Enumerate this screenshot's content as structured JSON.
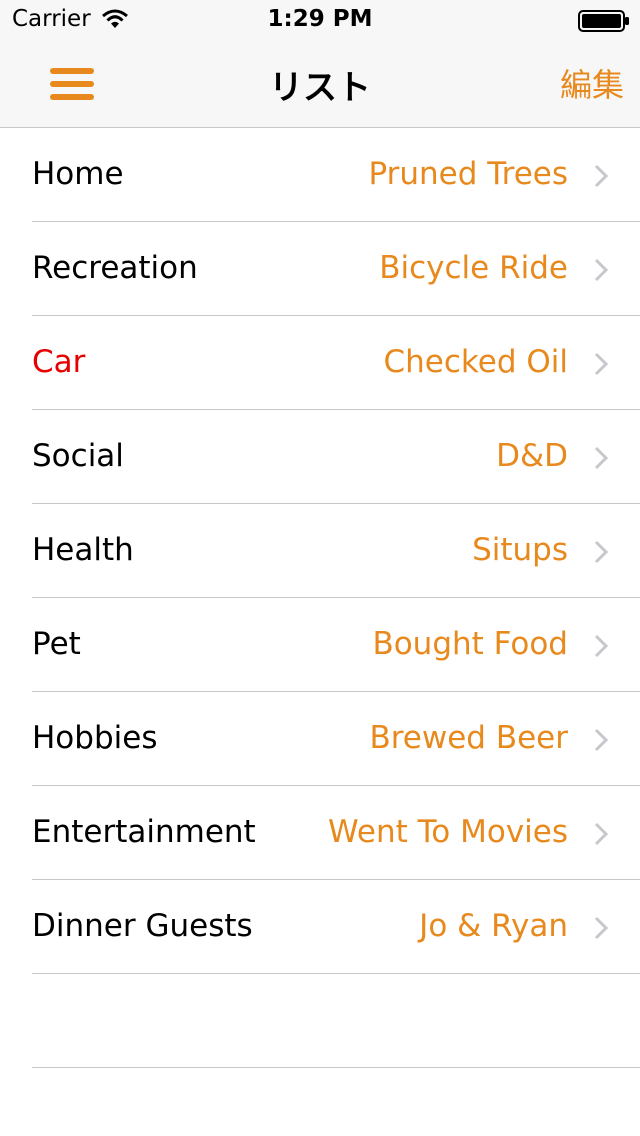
{
  "status_bar": {
    "carrier": "Carrier",
    "time": "1:29 PM",
    "icons": [
      "wifi-icon",
      "battery-icon"
    ]
  },
  "nav": {
    "title": "リスト",
    "edit_label": "編集",
    "menu_icon": "hamburger-menu-icon"
  },
  "colors": {
    "accent": "#e8891d",
    "alert": "#e60000",
    "separator": "#c8c7cc",
    "bar_background": "#f7f7f7"
  },
  "list": {
    "rows": [
      {
        "label": "Home",
        "value": "Pruned Trees"
      },
      {
        "label": "Recreation",
        "value": "Bicycle Ride"
      },
      {
        "label": "Car",
        "value": "Checked Oil"
      },
      {
        "label": "Social",
        "value": "D&D"
      },
      {
        "label": "Health",
        "value": "Situps"
      },
      {
        "label": "Pet",
        "value": "Bought Food"
      },
      {
        "label": "Hobbies",
        "value": "Brewed Beer"
      },
      {
        "label": "Entertainment",
        "value": "Went To Movies"
      },
      {
        "label": "Dinner Guests",
        "value": "Jo & Ryan"
      }
    ]
  }
}
